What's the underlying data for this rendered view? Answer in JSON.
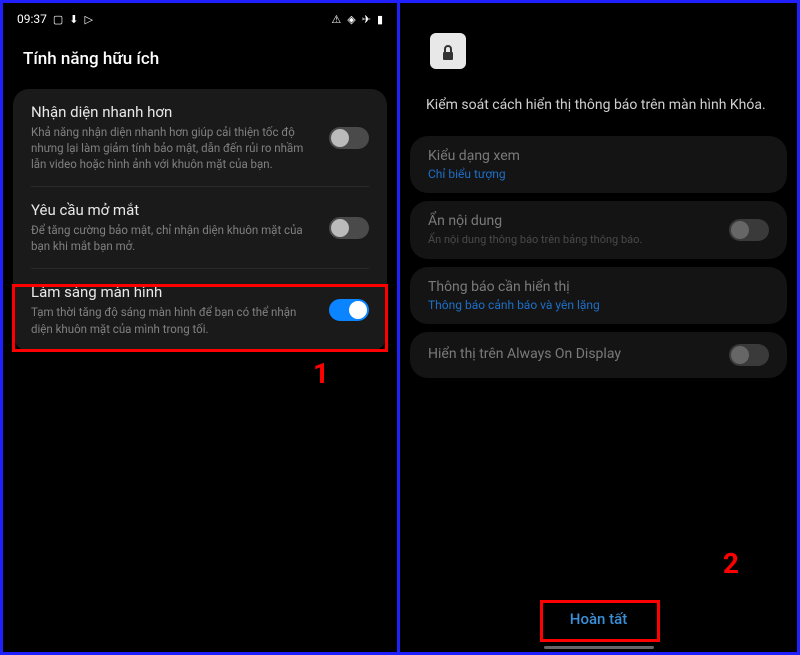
{
  "left": {
    "status": {
      "time": "09:37"
    },
    "title": "Tính năng hữu ích",
    "rows": [
      {
        "title": "Nhận diện nhanh hơn",
        "desc": "Khả năng nhận diện nhanh hơn giúp cải thiện tốc độ nhưng lại làm giảm tính bảo mật, dẫn đến rủi ro nhầm lẫn video hoặc hình ảnh với khuôn mặt của bạn.",
        "on": false
      },
      {
        "title": "Yêu cầu mở mắt",
        "desc": "Để tăng cường bảo mật, chỉ nhận diện khuôn mặt của bạn khi mắt bạn mở.",
        "on": false
      },
      {
        "title": "Làm sáng màn hình",
        "desc": "Tạm thời tăng độ sáng màn hình để bạn có thể nhận diện khuôn mặt của mình trong tối.",
        "on": true
      }
    ],
    "callout": "1"
  },
  "right": {
    "desc": "Kiểm soát cách hiển thị thông báo trên màn hình Khóa.",
    "rows": [
      {
        "title": "Kiểu dạng xem",
        "value": "Chỉ biểu tượng"
      },
      {
        "title": "Ẩn nội dung",
        "desc": "Ẩn nội dung thông báo trên bảng thông báo."
      },
      {
        "title": "Thông báo cần hiển thị",
        "value": "Thông báo cảnh báo và yên lặng"
      },
      {
        "title": "Hiển thị trên Always On Display"
      }
    ],
    "done": "Hoàn tất",
    "callout": "2"
  }
}
